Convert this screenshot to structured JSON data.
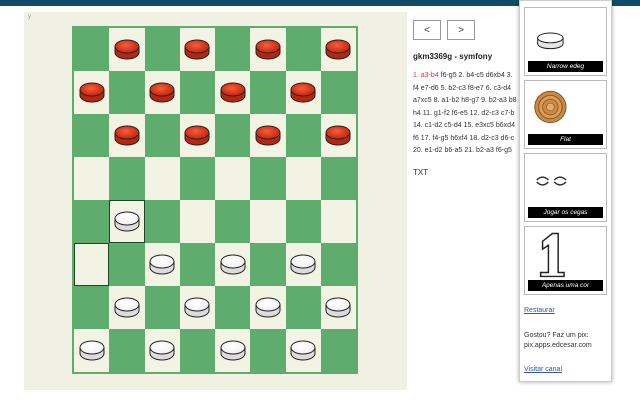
{
  "workspace": {
    "corner_mark": "y"
  },
  "board": {
    "rows": [
      [
        "",
        "r",
        "",
        "r",
        "",
        "r",
        "",
        "r"
      ],
      [
        "r",
        "",
        "r",
        "",
        "r",
        "",
        "r",
        ""
      ],
      [
        "",
        "r",
        "",
        "r",
        "",
        "r",
        "",
        "r"
      ],
      [
        "",
        "",
        "",
        "",
        "",
        "",
        "",
        ""
      ],
      [
        "",
        "w",
        "",
        "",
        "",
        "",
        "",
        ""
      ],
      [
        "",
        "",
        "w",
        "",
        "w",
        "",
        "w",
        ""
      ],
      [
        "",
        "w",
        "",
        "w",
        "",
        "w",
        "",
        "w"
      ],
      [
        "w",
        "",
        "w",
        "",
        "w",
        "",
        "w",
        ""
      ]
    ],
    "selected_squares": [
      "4-1",
      "5-0"
    ]
  },
  "nav": {
    "prev_label": "<",
    "next_label": ">"
  },
  "game": {
    "title": "gkm3369g - symfony",
    "current_move": "1. a3-b4",
    "moves_lines": [
      " f6-g5 2. b4-c5 d6xb4 3.",
      "f4 e7-d6 5. b2-c3 f8-e7 6. c3-d4",
      "a7xc5 8. a1-b2 h8-g7 9. b2-a3 b8",
      "h4 11. g1-f2 f6-e5 12. d2-c3 c7-b",
      "14. c1-d2 c5-d4 15. e3xc5 b6xd4",
      "f6 17. f4-g5 h6xf4 18. d2-c3 d6-c",
      "20. e1-d2 b6-a5 21. b2-a3 f6-g5"
    ],
    "txt_label": "TXT"
  },
  "panel": {
    "styles": [
      {
        "caption": "Narrow edeg"
      },
      {
        "caption": "Flat"
      },
      {
        "caption": "Jogar os cegas"
      },
      {
        "caption": "Apenas uma cor"
      }
    ],
    "restore_link": "Restaurar",
    "support_text": "Gostou? Faz um pix: pix.apps.edcesar.com",
    "channel_link": "Visitar canal"
  },
  "colors": {
    "board_dark": "#5fad6e",
    "board_light": "#f3f3e4",
    "piece_red": "#d73315",
    "piece_white": "#ffffff",
    "topbar": "#0f4c68"
  }
}
